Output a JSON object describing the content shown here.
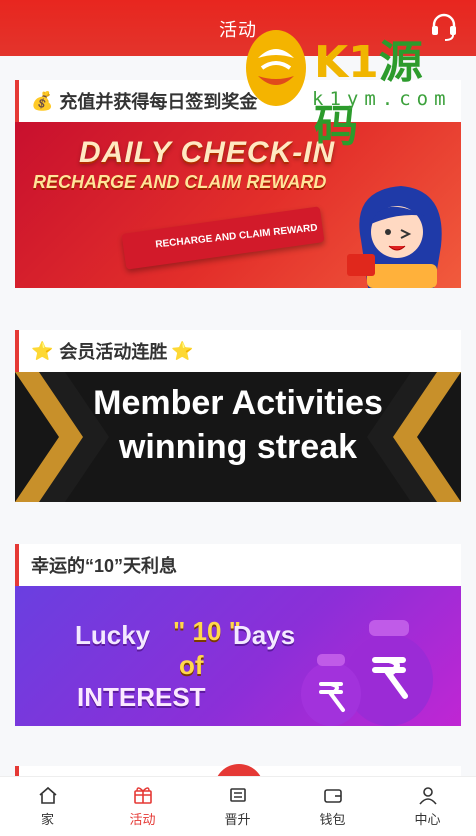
{
  "header": {
    "title": "活动",
    "support_icon": "headset-icon"
  },
  "watermark": {
    "brand_latin": "K1",
    "brand_cn": "源码",
    "url": "k1ym.com"
  },
  "cards": [
    {
      "icon": "money-bag-icon",
      "emoji": "💰",
      "title": "充值并获得每日签到奖金",
      "banner": {
        "line1": "DAILY CHECK-IN",
        "line2": "RECHARGE AND CLAIM REWARD",
        "ribbon": "RECHARGE AND CLAIM REWARD"
      }
    },
    {
      "icon": "star-icon",
      "emoji": "⭐",
      "title": "会员活动连胜",
      "emoji_right": "⭐",
      "banner": {
        "line1": "Member Activities",
        "line2": "winning streak"
      }
    },
    {
      "title": "幸运的“10”天利息",
      "banner": {
        "w1": "Lucky",
        "w2": "\" 10 \"",
        "w3": "Days",
        "w4": "of",
        "w5": "INTEREST"
      }
    }
  ],
  "tabbar": {
    "items": [
      {
        "label": "家",
        "icon": "home-icon"
      },
      {
        "label": "活动",
        "icon": "activity-icon",
        "active": true
      },
      {
        "label": "晋升",
        "icon": "promotion-icon"
      },
      {
        "label": "钱包",
        "icon": "wallet-icon"
      },
      {
        "label": "中心",
        "icon": "user-icon"
      }
    ]
  },
  "colors": {
    "primary": "#e53935",
    "header": "#e8261f",
    "background": "#f7f8fa"
  }
}
